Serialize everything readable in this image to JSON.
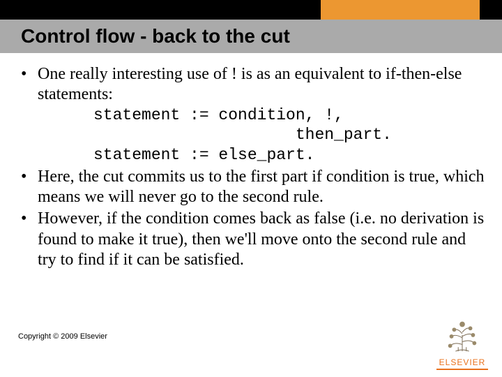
{
  "header": {
    "title": "Control flow - back to the cut"
  },
  "bullets": [
    {
      "text": "One really interesting use of ! is as an equivalent to if-then-else statements:",
      "code": "statement := condition, !,\n                     then_part.\nstatement := else_part."
    },
    {
      "text": "Here, the cut commits us to the first part if condition is true, which means we will never go to the second rule."
    },
    {
      "text": "However, if the condition comes back as false (i.e. no derivation is found to make it true), then we'll move onto the second rule and try to find if it can be satisfied."
    }
  ],
  "footer": {
    "copyright": "Copyright © 2009 Elsevier",
    "brand": "ELSEVIER"
  },
  "colors": {
    "accent_orange": "#ec9731",
    "brand_orange": "#e9711c",
    "title_bg": "#aaaaaa"
  }
}
